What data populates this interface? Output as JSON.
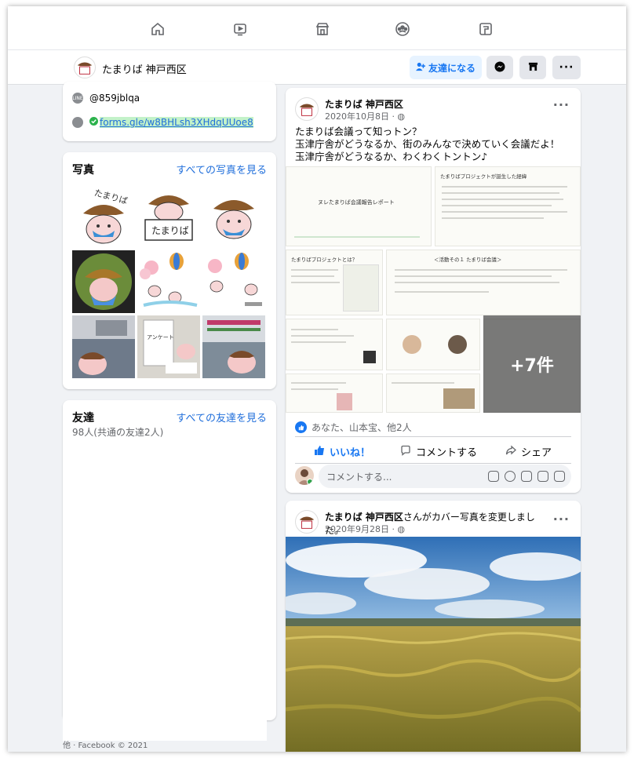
{
  "profile": {
    "name": "たまりば 神戸西区",
    "add_friend_label": "友達になる"
  },
  "intro": {
    "line_id": "@859jblqa",
    "link": "forms.gle/w8BHLsh3XHdqUUoe8"
  },
  "photos": {
    "title": "写真",
    "see_all": "すべての写真を見る",
    "tiles": [
      {
        "logo_text": "たまりば"
      },
      {
        "sign_text": "たまりば"
      },
      {},
      {},
      {},
      {},
      {},
      {
        "text": "アンケート"
      },
      {}
    ]
  },
  "friends": {
    "title": "友達",
    "see_all": "すべての友達を見る",
    "count": "98人(共通の友達2人)"
  },
  "footer": "他 · Facebook © 2021",
  "post1": {
    "author": "たまりば 神戸西区",
    "date": "2020年10月8日 · ",
    "text_lines": [
      "たまりば会議って知っトン？",
      "玉津庁舎がどうなるか、街のみんなで決めていく会議だよ！",
      "玉津庁舎がどうなるか、わくわくトントン♪"
    ],
    "slides": [
      {
        "title": "ヌレたまりば会議報告レポート"
      },
      {
        "title": "たまりばプロジェクトが誕生した経緯"
      },
      {
        "title": "たまりばプロジェクトとは？"
      },
      {
        "title": "＜活動その１ たまりば会議＞"
      }
    ],
    "more_count": "+7件",
    "reactions": "あなた、山本宝、他2人",
    "like_label": "いいね！",
    "comment_label": "コメントする",
    "share_label": "シェア",
    "comment_placeholder": "コメントする..."
  },
  "post2": {
    "author": "たまりば 神戸西区",
    "action": "さんがカバー写真を変更しました。",
    "date": "2020年9月28日 · "
  },
  "colors": {
    "accent": "#1877f2",
    "page_bg": "#f0f2f5"
  }
}
